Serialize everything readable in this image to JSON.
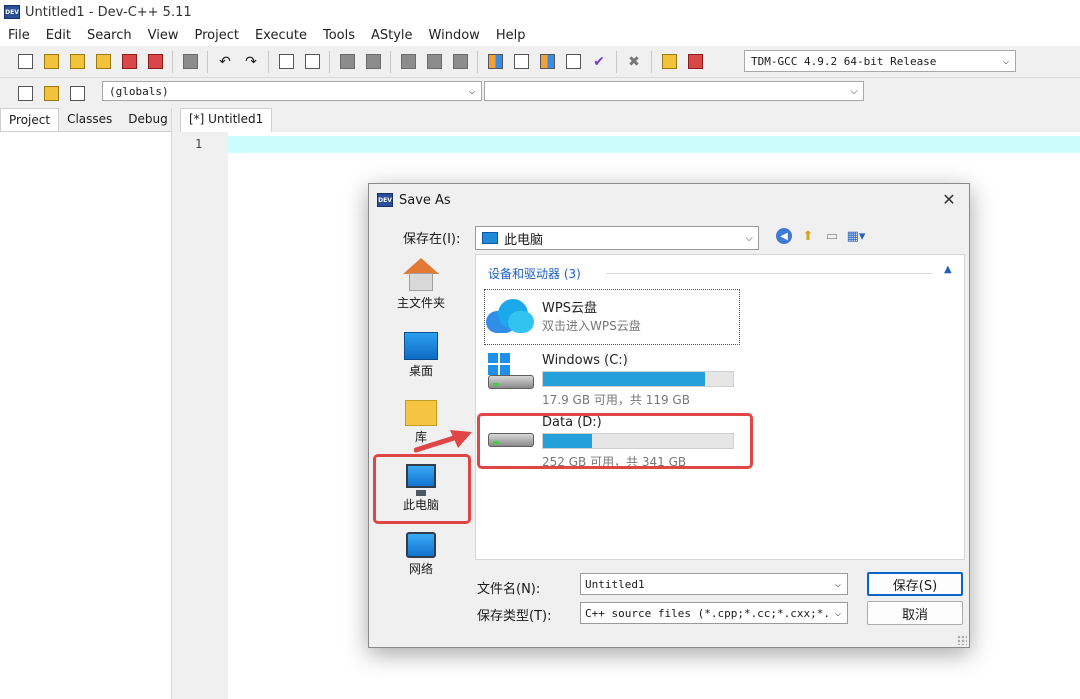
{
  "app": {
    "title": "Untitled1 - Dev-C++ 5.11",
    "icon_name": "devcpp-app-icon"
  },
  "menu": [
    "File",
    "Edit",
    "Search",
    "View",
    "Project",
    "Execute",
    "Tools",
    "AStyle",
    "Window",
    "Help"
  ],
  "toolbar": {
    "compiler": "TDM-GCC 4.9.2 64-bit Release",
    "scope": "(globals)",
    "members": ""
  },
  "left_panel": {
    "tabs": [
      "Project",
      "Classes",
      "Debug"
    ]
  },
  "editor": {
    "tab_label": "[*] Untitled1",
    "line_number": "1"
  },
  "dialog": {
    "title": "Save As",
    "save_in_label": "保存在(I):",
    "save_in_value": "此电脑",
    "places": [
      "主文件夹",
      "桌面",
      "库",
      "此电脑",
      "网络"
    ],
    "group_header": "设备和驱动器 (3)",
    "drives": [
      {
        "name": "WPS云盘",
        "sub": "双击进入WPS云盘"
      },
      {
        "name": "Windows (C:)",
        "sub": "17.9 GB 可用，共 119 GB",
        "used_fraction": 0.85
      },
      {
        "name": "Data (D:)",
        "sub": "252 GB 可用，共 341 GB",
        "used_fraction": 0.26
      }
    ],
    "filename_label": "文件名(N):",
    "filename_value": "Untitled1",
    "filetype_label": "保存类型(T):",
    "filetype_value": "C++ source files (*.cpp;*.cc;*.cxx;*.c++;*.cp)",
    "save_button": "保存(S)",
    "cancel_button": "取消"
  },
  "colors": {
    "highlight": "#e04646",
    "line_highlight": "#ccfcfc",
    "drive_bar": "#26a0da"
  }
}
